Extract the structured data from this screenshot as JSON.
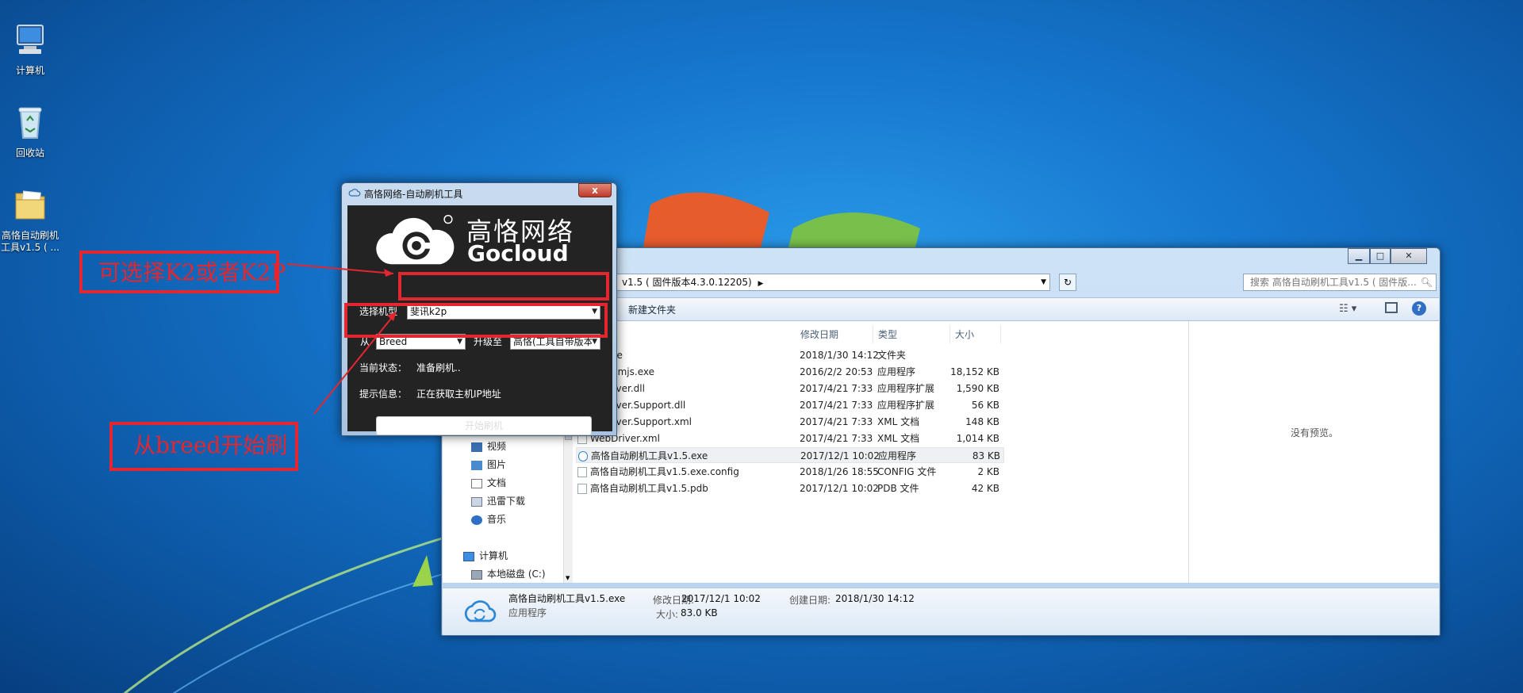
{
  "desktop": {
    "icons": [
      {
        "label": "计算机"
      },
      {
        "label": "回收站"
      },
      {
        "label": "高恪自动刷机\n工具v1.5 ( ..."
      }
    ]
  },
  "annotations": {
    "select_k2": "可选择K2或者K2P",
    "from_breed": "从breed开始刷"
  },
  "tool": {
    "title": "高恪网络-自动刷机工具",
    "close": "x",
    "brand_cn": "高恪网络",
    "brand_en": "Gocloud",
    "model_label": "选择机型",
    "model_value": "斐讯k2p",
    "from_label": "从",
    "from_value": "Breed",
    "upgrade_label": "升级至",
    "upgrade_value": "高恪(工具自带版本",
    "status_label": "当前状态：",
    "status_value": "准备刷机..",
    "hint_label": "提示信息：",
    "hint_value": "正在获取主机IP地址",
    "start_button": "开始刷机"
  },
  "explorer": {
    "address": "v1.5 ( 固件版本4.3.0.12205)",
    "search_placeholder": "搜索 高恪自动刷机工具v1.5 ( 固件版...",
    "new_folder": "新建文件夹",
    "columns": {
      "date": "修改日期",
      "type": "类型",
      "size": "大小"
    },
    "files": [
      {
        "name": "mware",
        "date": "2018/1/30 14:12",
        "type": "文件夹",
        "size": ""
      },
      {
        "name": "hantomjs.exe",
        "date": "2016/2/2 20:53",
        "type": "应用程序",
        "size": "18,152 KB"
      },
      {
        "name": "ebDriver.dll",
        "date": "2017/4/21 7:33",
        "type": "应用程序扩展",
        "size": "1,590 KB"
      },
      {
        "name": "ebDriver.Support.dll",
        "date": "2017/4/21 7:33",
        "type": "应用程序扩展",
        "size": "56 KB"
      },
      {
        "name": "ebDriver.Support.xml",
        "date": "2017/4/21 7:33",
        "type": "XML 文档",
        "size": "148 KB"
      },
      {
        "name": "WebDriver.xml",
        "date": "2017/4/21 7:33",
        "type": "XML 文档",
        "size": "1,014 KB"
      },
      {
        "name": "高恪自动刷机工具v1.5.exe",
        "date": "2017/12/1 10:02",
        "type": "应用程序",
        "size": "83 KB"
      },
      {
        "name": "高恪自动刷机工具v1.5.exe.config",
        "date": "2018/1/26 18:55",
        "type": "CONFIG 文件",
        "size": "2 KB"
      },
      {
        "name": "高恪自动刷机工具v1.5.pdb",
        "date": "2017/12/1 10:02",
        "type": "PDB 文件",
        "size": "42 KB"
      }
    ],
    "nav": [
      {
        "label": "视频"
      },
      {
        "label": "图片"
      },
      {
        "label": "文档"
      },
      {
        "label": "迅雷下载"
      },
      {
        "label": "音乐"
      },
      {
        "label": "计算机"
      },
      {
        "label": "本地磁盘 (C:)"
      }
    ],
    "preview": "没有预览。",
    "details": {
      "name": "高恪自动刷机工具v1.5.exe",
      "kind": "应用程序",
      "modified_label": "修改日期:",
      "modified": "2017/12/1 10:02",
      "size_label": "大小:",
      "size": "83.0 KB",
      "created_label": "创建日期:",
      "created": "2018/1/30 14:12"
    }
  }
}
